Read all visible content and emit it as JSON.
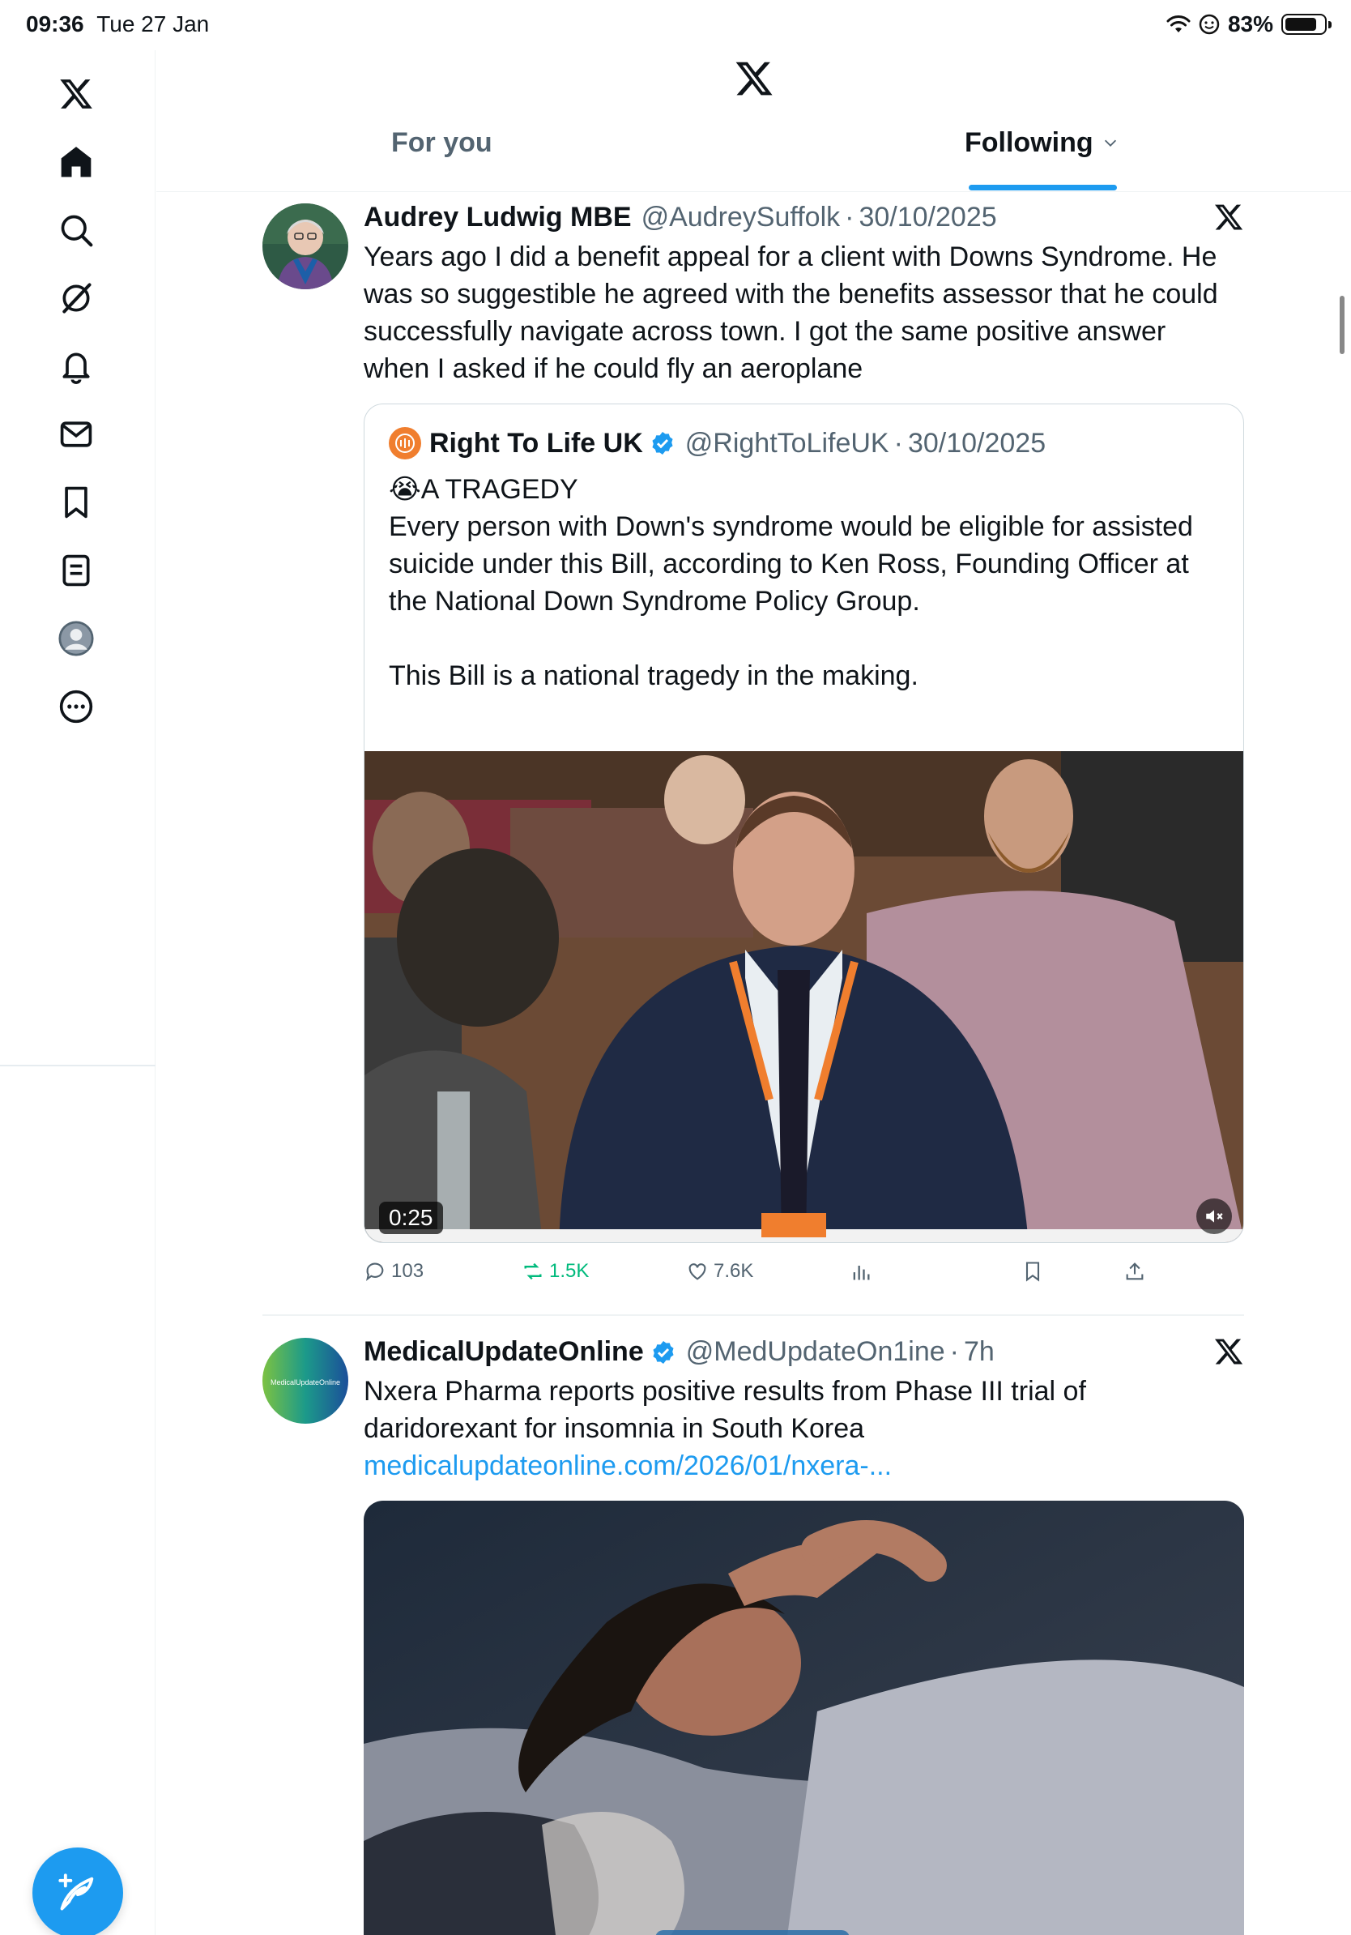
{
  "status_bar": {
    "time": "09:36",
    "date": "Tue 27 Jan",
    "battery": "83%",
    "battery_level": 0.83
  },
  "header": {
    "tabs": [
      {
        "label": "For you",
        "active": false
      },
      {
        "label": "Following",
        "active": true
      }
    ]
  },
  "sidebar": {
    "items": [
      "x-logo",
      "home-icon",
      "search-icon",
      "grok-icon",
      "notifications-icon",
      "messages-icon",
      "bookmarks-icon",
      "lists-icon",
      "profile-icon",
      "more-icon"
    ]
  },
  "colors": {
    "accent": "#1d9bf0",
    "text": "#0f1419",
    "secondary": "#536471",
    "retweet": "#00ba7c"
  },
  "tweets": [
    {
      "name": "Audrey Ludwig MBE",
      "handle": "@AudreySuffolk",
      "sep": "·",
      "time": "30/10/2025",
      "text": "Years ago I did a benefit appeal for a client with Downs Syndrome. He was so suggestible he agreed with the benefits assessor that he could successfully navigate across town. I got the same positive answer when I asked if he could fly an aeroplane",
      "quote": {
        "name": "Right To Life UK",
        "handle": "@RightToLifeUK",
        "sep": "·",
        "time": "30/10/2025",
        "emoji": "😭",
        "line1": "A TRAGEDY",
        "body": "\nEvery person with Down's syndrome would be eligible for assisted suicide under this Bill, according to Ken Ross, Founding Officer at the National Down Syndrome Policy Group.\n\nThis Bill is a national tragedy in the making.",
        "video_duration": "0:25"
      },
      "stats": {
        "replies": "103",
        "reposts": "1.5K",
        "likes": "7.6K"
      }
    },
    {
      "name": "MedicalUpdateOnline",
      "handle": "@MedUpdateOn1ine",
      "sep": "·",
      "time": "7h",
      "text_plain": "Nxera Pharma reports positive results from Phase III trial of daridorexant for insomnia in South Korea ",
      "text_link": "medicalupdateonline.com/2026/01/nxera-...",
      "avatar_text": "MedicalUpdateOnline"
    }
  ]
}
